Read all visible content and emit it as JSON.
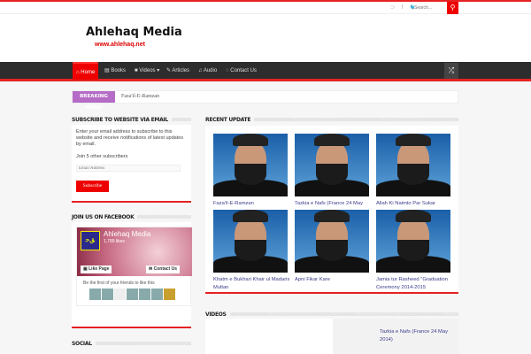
{
  "topbar": {
    "social_icons": [
      "rss-icon",
      "facebook-icon",
      "twitter-icon"
    ],
    "search_placeholder": "Search..."
  },
  "header": {
    "logo": "Ahlehaq Media",
    "url": "www.ahlehaq.net"
  },
  "nav": {
    "items": [
      {
        "label": "Home",
        "icon": "home-icon"
      },
      {
        "label": "Books",
        "icon": "book-icon"
      },
      {
        "label": "Videos ▾",
        "icon": "video-icon"
      },
      {
        "label": "Articles",
        "icon": "pencil-icon"
      },
      {
        "label": "Audio",
        "icon": "music-icon"
      },
      {
        "label": "Contact Us",
        "icon": "chat-icon"
      }
    ]
  },
  "breaking": {
    "label": "BREAKING NEWS",
    "text": "Faza'il-E-Ramzan"
  },
  "subscribe": {
    "title": "SUBSCRIBE TO WEBSITE VIA EMAIL",
    "desc": "Enter your email address to subscribe to this website and receive notifications of latest updates by email.",
    "count": "Join 5 other subscribers",
    "placeholder": "Email Address",
    "button": "Subscribe"
  },
  "facebook": {
    "title": "JOIN US ON FACEBOOK",
    "page_name": "Ahlehaq Media",
    "likes": "1,789 likes",
    "like_btn": "Like Page",
    "contact_btn": "Contact Us",
    "friends": "Be the first of your friends to like this"
  },
  "social": {
    "title": "SOCIAL"
  },
  "recent": {
    "title": "RECENT UPDATE",
    "items": [
      "Faza'il-E-Ramzan",
      "Tazkia e Nafs (France 24 May",
      "Allah Ki Naimto Par Sukar",
      "Khatm e Bukhari Khair ul Madaris Multan",
      "Apni Fikar Kare",
      "Jamia tur Rasheed \"Graduation Ceremony 2014-2015"
    ]
  },
  "videos": {
    "title": "VIDEOS",
    "item": "Tazkia e Nafs (France 24 May 2014)"
  }
}
